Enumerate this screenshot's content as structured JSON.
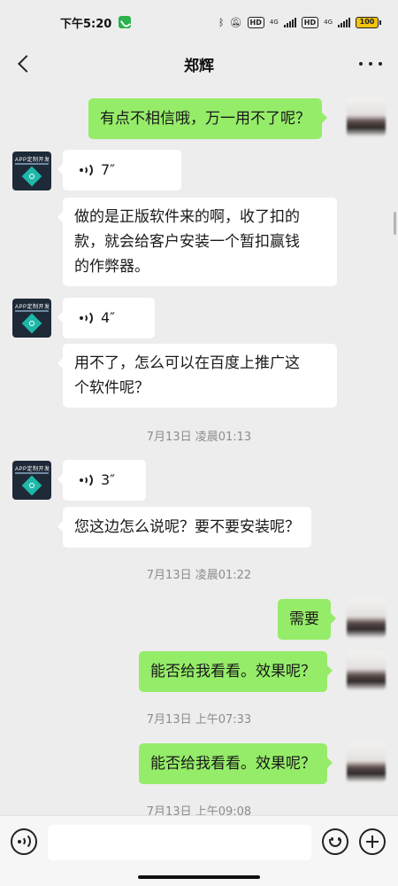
{
  "status_bar": {
    "time": "下午5:20",
    "hd1": "HD",
    "net1": "4G",
    "hd2": "HD",
    "net2": "4G",
    "battery": "100"
  },
  "header": {
    "title": "郑辉"
  },
  "messages": [
    {
      "side": "right",
      "type": "text",
      "text": "有点不相信哦，万一用不了呢？"
    },
    {
      "side": "left",
      "type": "voice",
      "duration": "7″"
    },
    {
      "side": "left",
      "type": "text",
      "lines": [
        "做的是正版软件来的啊，收了扣的",
        "款，就会给客户安装一个暂扣赢钱",
        "的作弊器。"
      ]
    },
    {
      "side": "left",
      "type": "voice",
      "duration": "4″"
    },
    {
      "side": "left",
      "type": "text",
      "lines": [
        "用不了，怎么可以在百度上推广这",
        "个软件呢？"
      ]
    },
    {
      "type": "time",
      "text": "7月13日 凌晨01:13"
    },
    {
      "side": "left",
      "type": "voice",
      "duration": "3″"
    },
    {
      "side": "left",
      "type": "text",
      "text": "您这边怎么说呢？要不要安装呢？"
    },
    {
      "type": "time",
      "text": "7月13日 凌晨01:22"
    },
    {
      "side": "right",
      "type": "text",
      "text": "需要"
    },
    {
      "side": "right",
      "type": "text",
      "text": "能否给我看看。效果呢？"
    },
    {
      "type": "time",
      "text": "7月13日 上午07:33"
    },
    {
      "side": "right",
      "type": "text",
      "text": "能否给我看看。效果呢？"
    },
    {
      "type": "time",
      "text": "7月13日 上午09:08"
    }
  ],
  "avatar_text": "APP定制开发",
  "input": {
    "value": "",
    "placeholder": ""
  },
  "colors": {
    "background": "#ededed",
    "sent_bubble": "#95ec69",
    "received_bubble": "#ffffff"
  }
}
